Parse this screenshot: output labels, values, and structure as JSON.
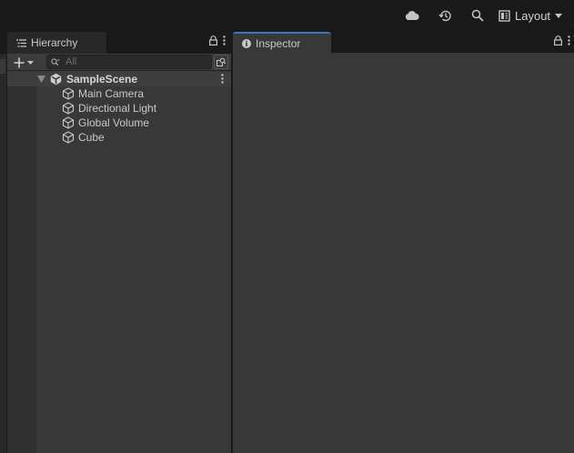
{
  "toolbar": {
    "icons": [
      "cloud-icon",
      "history-icon",
      "search-icon",
      "layout-icon"
    ],
    "layout_label": "Layout"
  },
  "hierarchy": {
    "tab_label": "Hierarchy",
    "search_placeholder": "All",
    "scene": {
      "name": "SampleScene",
      "objects": [
        {
          "name": "Main Camera"
        },
        {
          "name": "Directional Light"
        },
        {
          "name": "Global Volume"
        },
        {
          "name": "Cube"
        }
      ]
    }
  },
  "inspector": {
    "tab_label": "Inspector"
  },
  "colors": {
    "background": "#191919",
    "panel": "#383838",
    "accent": "#3a79bb",
    "text": "#c4c4c4"
  }
}
